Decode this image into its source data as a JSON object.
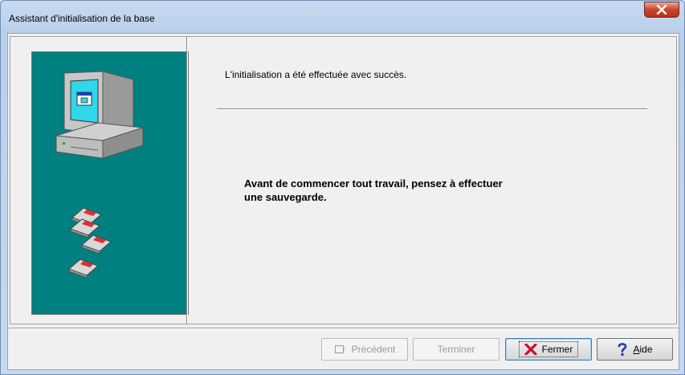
{
  "window": {
    "title": "Assistant d'initialisation de la base"
  },
  "content": {
    "success_message": "L'initialisation a été effectuée avec succès.",
    "backup_line1": "Avant de commencer tout travail, pensez à effectuer",
    "backup_line2": "une sauvegarde."
  },
  "buttons": {
    "previous": "Précédent",
    "finish": "Terminer",
    "close_label": "Fermer",
    "help_prefix": "",
    "help_accel": "A",
    "help_rest": "ide"
  },
  "colors": {
    "wizard_panel": "#008080",
    "close_icon": "#c8102e",
    "help_icon": "#1a3fb0"
  },
  "icons": {
    "wizard_computer": "computer-icon",
    "floppies": "floppy-disk-icon",
    "previous": "previous-page-icon",
    "close": "red-x-icon",
    "help": "question-mark-icon"
  }
}
